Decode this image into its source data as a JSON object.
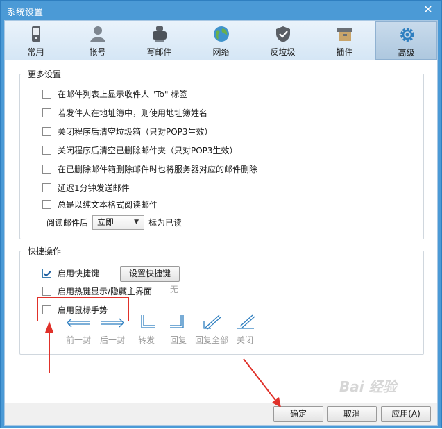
{
  "window": {
    "title": "系统设置"
  },
  "toolbar": {
    "items": [
      {
        "label": "常用",
        "icon": "phone-icon"
      },
      {
        "label": "帐号",
        "icon": "user-icon"
      },
      {
        "label": "写邮件",
        "icon": "compose-icon"
      },
      {
        "label": "网络",
        "icon": "globe-icon"
      },
      {
        "label": "反垃圾",
        "icon": "shield-icon"
      },
      {
        "label": "插件",
        "icon": "box-icon"
      },
      {
        "label": "高级",
        "icon": "gear-icon",
        "active": true
      }
    ]
  },
  "more_settings": {
    "legend": "更多设置",
    "options": [
      {
        "label": "在邮件列表上显示收件人 \"To\" 标签",
        "checked": false
      },
      {
        "label": "若发件人在地址簿中，则使用地址簿姓名",
        "checked": false
      },
      {
        "label": "关闭程序后清空垃圾箱（只对POP3生效）",
        "checked": false
      },
      {
        "label": "关闭程序后清空已删除邮件夹（只对POP3生效）",
        "checked": false
      },
      {
        "label": "在已删除邮件箱删除邮件时也将服务器对应的邮件删除",
        "checked": false
      },
      {
        "label": "延迟1分钟发送邮件",
        "checked": false
      },
      {
        "label": "总是以纯文本格式阅读邮件",
        "checked": false
      }
    ],
    "read_mail_prefix": "阅读邮件后",
    "read_mail_select": "立即",
    "read_mail_suffix": "标为已读"
  },
  "shortcuts": {
    "legend": "快捷操作",
    "enable_hotkeys": {
      "label": "启用快捷键",
      "checked": true
    },
    "set_hotkeys_button": "设置快捷键",
    "hotkey_toggle": {
      "label": "启用热键显示/隐藏主界面",
      "checked": false
    },
    "hotkey_value": "无",
    "mouse_gesture": {
      "label": "启用鼠标手势",
      "checked": false
    },
    "gestures": [
      "前一封",
      "后一封",
      "转发",
      "回复",
      "回复全部",
      "关闭"
    ]
  },
  "footer": {
    "ok": "确定",
    "cancel": "取消",
    "apply": "应用(A)"
  },
  "watermark": "Bai 经验",
  "colors": {
    "accent": "#4b9ad6",
    "highlight": "#e0312a",
    "gesture": "#2f7fc0"
  }
}
